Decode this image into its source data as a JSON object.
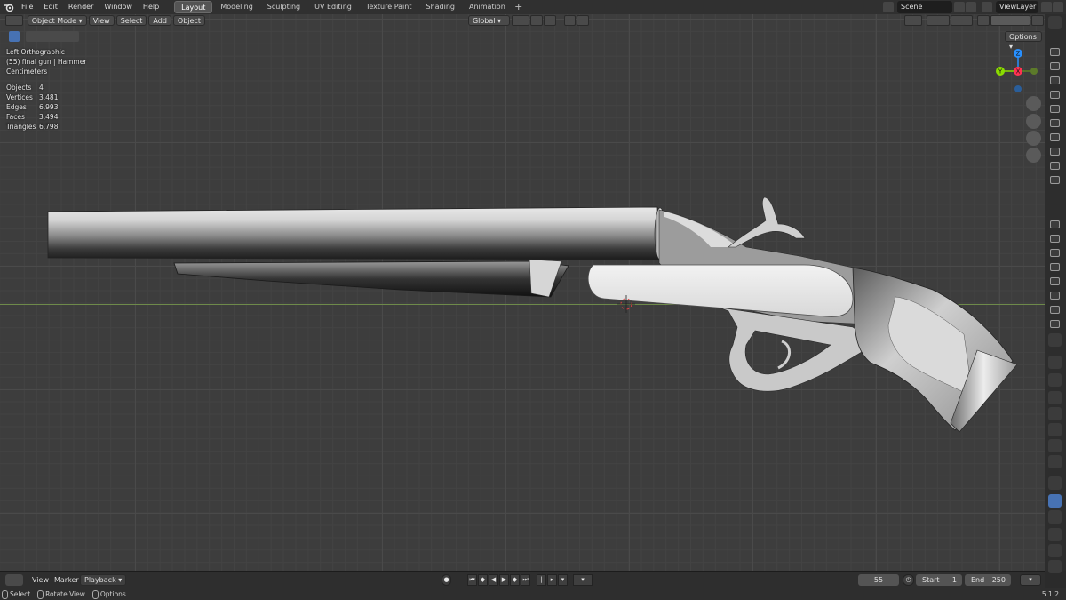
{
  "menu": [
    "File",
    "Edit",
    "Render",
    "Window",
    "Help"
  ],
  "workspaces": [
    "Layout",
    "Modeling",
    "Sculpting",
    "UV Editing",
    "Texture Paint",
    "Shading",
    "Animation"
  ],
  "active_workspace": "Layout",
  "scene": "Scene",
  "view_layer": "ViewLayer",
  "viewport_header": {
    "mode": "Object Mode",
    "menus": [
      "View",
      "Select",
      "Add",
      "Object"
    ],
    "orientation": "Global",
    "options": "Options"
  },
  "overlay": {
    "view_name": "Left Orthographic",
    "object_info": "(55) final gun | Hammer",
    "units": "Centimeters",
    "stats": [
      {
        "label": "Objects",
        "value": "4"
      },
      {
        "label": "Vertices",
        "value": "3,481"
      },
      {
        "label": "Edges",
        "value": "6,993"
      },
      {
        "label": "Faces",
        "value": "3,494"
      },
      {
        "label": "Triangles",
        "value": "6,798"
      }
    ]
  },
  "gizmo": {
    "z": "Z",
    "y": "Y",
    "x": "X"
  },
  "timeline": {
    "menus": [
      "View",
      "Marker"
    ],
    "playback": "Playback",
    "current_frame": "55",
    "start_label": "Start",
    "start": "1",
    "end_label": "End",
    "end": "250"
  },
  "statusbar": {
    "select": "Select",
    "rotate": "Rotate View",
    "options": "Options",
    "version": "5.1.2"
  },
  "colors": {
    "accent": "#4772b3",
    "axis_x": "#ff3352",
    "axis_y": "#8bdc00",
    "axis_z": "#2890ff"
  }
}
